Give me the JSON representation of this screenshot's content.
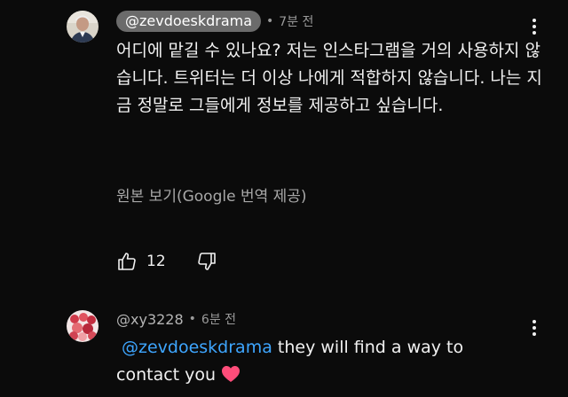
{
  "comment1": {
    "handle": "@zevdoeskdrama",
    "separator": "•",
    "time": "7분 전",
    "text": "어디에 맡길 수 있나요? 저는 인스타그램을 거의 사용하지 않습니다. 트위터는 더 이상 나에게 적합하지 않습니다. 나는 지금 정말로 그들에게 정보를 제공하고 싶습니다.",
    "translate_link": "원본 보기(Google 번역 제공)",
    "like_count": "12",
    "icons": {
      "menu": "more-vert-icon",
      "like": "thumb-up-icon",
      "dislike": "thumb-down-icon"
    }
  },
  "comment2": {
    "handle": "@xy3228",
    "separator": "•",
    "time": "6분 전",
    "mention": "@zevdoeskdrama",
    "text": "they will find a way to contact you",
    "emoji": "heart-icon",
    "icons": {
      "menu": "more-vert-icon"
    }
  },
  "colors": {
    "background": "#0b0b0b",
    "text": "#f1f1f1",
    "secondary_text": "#9a9a9a",
    "mention_link": "#3ea6ff",
    "handle_pill": "#6b6b6b",
    "heart": "#ff4d7a"
  }
}
